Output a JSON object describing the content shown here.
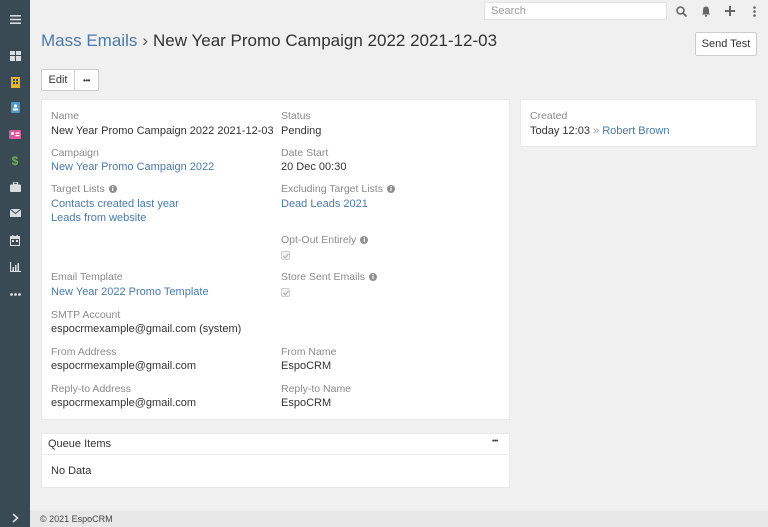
{
  "search": {
    "placeholder": "Search"
  },
  "header": {
    "scope_link": "Mass Emails",
    "separator": "›",
    "record_title": "New Year Promo Campaign 2022 2021-12-03"
  },
  "buttons": {
    "send_test": "Send Test",
    "edit": "Edit",
    "more": "•••"
  },
  "details": {
    "name": {
      "label": "Name",
      "value": "New Year Promo Campaign 2022 2021-12-03"
    },
    "status": {
      "label": "Status",
      "value": "Pending"
    },
    "campaign": {
      "label": "Campaign",
      "value": "New Year Promo Campaign 2022"
    },
    "date_start": {
      "label": "Date Start",
      "value": "20 Dec 00:30"
    },
    "target_lists": {
      "label": "Target Lists",
      "values": [
        "Contacts created last year",
        "Leads from website"
      ]
    },
    "excluding_target_lists": {
      "label": "Excluding Target Lists",
      "values": [
        "Dead Leads 2021"
      ]
    },
    "opt_out_entirely": {
      "label": "Opt-Out Entirely",
      "checked": true
    },
    "email_template": {
      "label": "Email Template",
      "value": "New Year 2022 Promo Template"
    },
    "store_sent_emails": {
      "label": "Store Sent Emails",
      "checked": true
    },
    "smtp_account": {
      "label": "SMTP Account",
      "value": "espocrmexample@gmail.com (system)"
    },
    "from_address": {
      "label": "From Address",
      "value": "espocrmexample@gmail.com"
    },
    "from_name": {
      "label": "From Name",
      "value": "EspoCRM"
    },
    "reply_to_address": {
      "label": "Reply-to Address",
      "value": "espocrmexample@gmail.com"
    },
    "reply_to_name": {
      "label": "Reply-to Name",
      "value": "EspoCRM"
    }
  },
  "side": {
    "created": {
      "label": "Created",
      "time": "Today 12:03",
      "separator": "»",
      "user": "Robert Brown"
    }
  },
  "queue": {
    "title": "Queue Items",
    "menu": "•••",
    "empty": "No Data"
  },
  "footer": {
    "text": "© 2021 EspoCRM"
  },
  "sidebar_icons": [
    "menu-icon",
    "dashboard-icon",
    "accounts-icon",
    "contacts-icon",
    "leads-icon",
    "opportunities-icon",
    "cases-icon",
    "emails-icon",
    "calendar-icon",
    "reports-icon",
    "more-icon",
    "expand-icon"
  ],
  "colors": {
    "sidebar": "#3a4a54",
    "link": "#4a7aa8",
    "icon_yellow": "#e6b32e",
    "icon_blue": "#4e9ac8",
    "icon_pink": "#d85a9c",
    "icon_green": "#6ab04c"
  }
}
